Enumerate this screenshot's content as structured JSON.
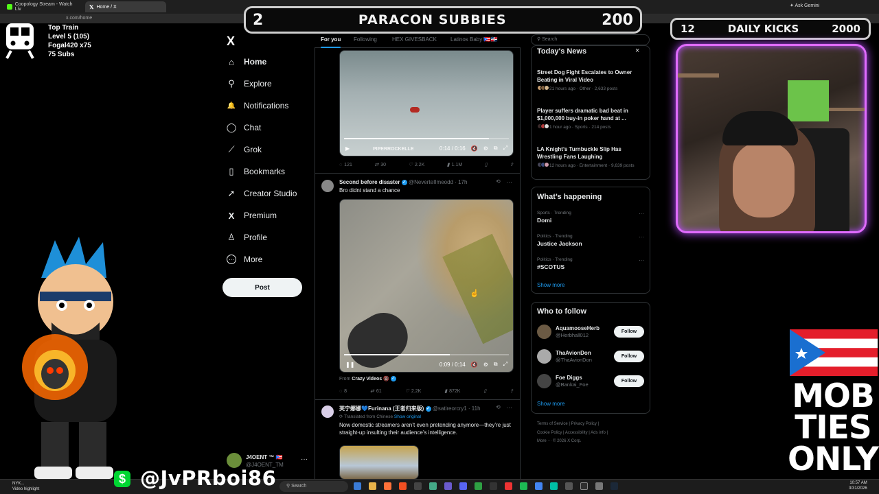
{
  "browser": {
    "tabs": [
      {
        "label": "Coopology Stream - Watch Liv"
      },
      {
        "label": "Home / X"
      }
    ],
    "url": "x.com/home",
    "ask_gemini": "Ask Gemini"
  },
  "overlay": {
    "train": {
      "line1": "Top Train",
      "line2": "Level 5  (105)",
      "line3": "Fogal420 x75",
      "line4": "75 Subs"
    },
    "paracon": {
      "left": "2",
      "title": "PARACON SUBBIES",
      "right": "200"
    },
    "kicks": {
      "left": "12",
      "title": "DAILY KICKS",
      "right": "2000"
    },
    "handle": "@JvPRboi86",
    "dollar": "$",
    "mobties": [
      "MOB",
      "TIES",
      "ONLY"
    ]
  },
  "sidebar": {
    "logo": "X",
    "items": [
      {
        "label": "Home",
        "icon": "⌂"
      },
      {
        "label": "Explore",
        "icon": "⚲"
      },
      {
        "label": "Notifications",
        "icon": "🔔"
      },
      {
        "label": "Chat",
        "icon": "◯"
      },
      {
        "label": "Grok",
        "icon": "⟋"
      },
      {
        "label": "Bookmarks",
        "icon": "▯"
      },
      {
        "label": "Creator Studio",
        "icon": "➚"
      },
      {
        "label": "Premium",
        "icon": "X"
      },
      {
        "label": "Profile",
        "icon": "♙"
      },
      {
        "label": "More",
        "icon": "⋯"
      }
    ],
    "post": "Post",
    "account": {
      "name": "J4OENT ™ 🇵🇷",
      "handle": "@J4OENT_TM",
      "dots": "···"
    }
  },
  "feed": {
    "tabs": [
      "For you",
      "Following",
      "HEX GIVESBACK",
      "Latinos Baby!🇵🇷🇩🇴"
    ],
    "tweet1": {
      "video_time": "0:14 / 0:16",
      "watermark": "PIPERROCKELLE",
      "replies": "121",
      "reposts": "30",
      "likes": "2.2K",
      "views": "1.1M"
    },
    "tweet2": {
      "name": "Second before disaster",
      "handle": "@NeverteIImeodd · 17h",
      "text": "Bro didnt stand a chance",
      "video_time": "0:09 / 0:14",
      "progress": 0.64,
      "from_label": "From",
      "from_source": "Crazy Videos 🔞",
      "replies": "8",
      "reposts": "61",
      "likes": "2.2K",
      "views": "872K"
    },
    "tweet3": {
      "name": "芙宁娜娜💙Furinana (王者归来版)",
      "handle": "@satireorcry1 · 11h",
      "translated": "Translated from Chinese",
      "show_original": "Show original",
      "text": "Now domestic streamers aren’t even pretending anymore—they’re just straight-up insulting their audience’s intelligence."
    }
  },
  "right": {
    "search_placeholder": "Search",
    "news_title": "Today's News",
    "close": "×",
    "news": [
      {
        "headline": "Street Dog Fight Escalates to Owner Beating in Viral Video",
        "meta": "21 hours ago · Other · 2,633 posts"
      },
      {
        "headline": "Player suffers dramatic bad beat in $1,000,000 buy-in poker hand at ...",
        "meta": "1 hour ago · Sports · 214 posts"
      },
      {
        "headline": "LA Knight’s Turnbuckle Slip Has Wrestling Fans Laughing",
        "meta": "12 hours ago · Entertainment · 9,639 posts"
      }
    ],
    "happening_title": "What’s happening",
    "trends": [
      {
        "category": "Sports · Trending",
        "topic": "Domi"
      },
      {
        "category": "Politics · Trending",
        "topic": "Justice Jackson"
      },
      {
        "category": "Politics · Trending",
        "topic": "#SCOTUS"
      }
    ],
    "show_more": "Show more",
    "who_title": "Who to follow",
    "follow": [
      {
        "name": "AquamooseHerb",
        "handle": "@Herbhall012",
        "button": "Follow"
      },
      {
        "name": "ThaAvionDon",
        "handle": "@ThaAvionDon",
        "button": "Follow"
      },
      {
        "name": "Foe Diggs",
        "handle": "@Bankai_Foe",
        "button": "Follow"
      }
    ],
    "footer": {
      "line1": "Terms of Service  |  Privacy Policy  |",
      "line2": "Cookie Policy  |  Accessibility  |  Ads info  |",
      "line3": "More ···  © 2026 X Corp."
    }
  },
  "taskbar": {
    "search": "Search",
    "news_line1": "NYK...",
    "news_line2": "Video highlight",
    "time": "10:57 AM",
    "date": "3/31/2026"
  }
}
